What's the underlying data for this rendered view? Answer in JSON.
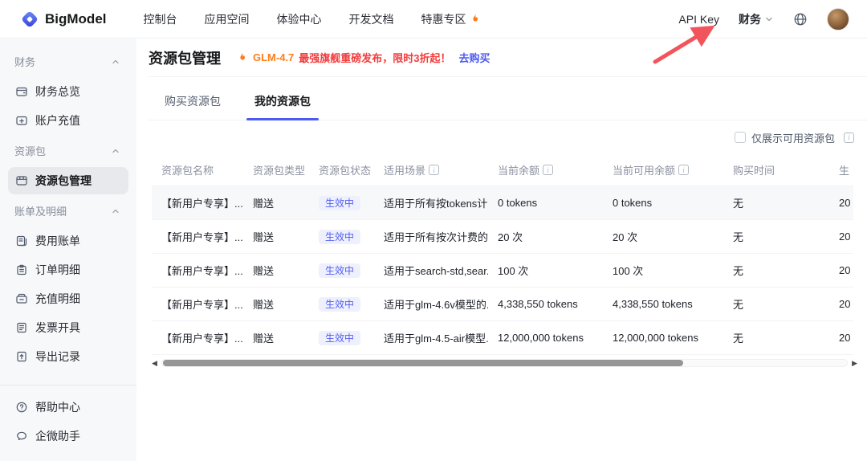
{
  "topbar": {
    "brand": "BigModel",
    "nav": [
      {
        "key": "console",
        "label": "控制台"
      },
      {
        "key": "app-space",
        "label": "应用空间"
      },
      {
        "key": "experience-center",
        "label": "体验中心"
      },
      {
        "key": "dev-docs",
        "label": "开发文档"
      },
      {
        "key": "promo-zone",
        "label": "特惠专区",
        "flame": true
      }
    ],
    "api_key_label": "API Key",
    "account_label": "财务",
    "annotation": {
      "type": "red-arrow",
      "points_to": "API Key",
      "color": "#f2545b"
    }
  },
  "sidebar": {
    "groups": [
      {
        "key": "finance",
        "label": "财务",
        "items": [
          {
            "key": "finance-overview",
            "icon": "wallet-icon",
            "label": "财务总览"
          },
          {
            "key": "account-recharge",
            "icon": "recharge-icon",
            "label": "账户充值"
          }
        ]
      },
      {
        "key": "resource-package",
        "label": "资源包",
        "items": [
          {
            "key": "resource-package-management",
            "icon": "package-icon",
            "label": "资源包管理",
            "active": true
          }
        ]
      },
      {
        "key": "bills-details",
        "label": "账单及明细",
        "items": [
          {
            "key": "expense-bills",
            "icon": "bill-icon",
            "label": "费用账单"
          },
          {
            "key": "order-details",
            "icon": "order-icon",
            "label": "订单明细"
          },
          {
            "key": "recharge-details",
            "icon": "recharge-detail-icon",
            "label": "充值明细"
          },
          {
            "key": "invoice-issue",
            "icon": "invoice-icon",
            "label": "发票开具"
          },
          {
            "key": "export-records",
            "icon": "export-icon",
            "label": "导出记录"
          }
        ]
      }
    ],
    "footer": [
      {
        "key": "help-center",
        "icon": "help-icon",
        "label": "帮助中心"
      },
      {
        "key": "wecom-assistant",
        "icon": "chat-icon",
        "label": "企微助手"
      }
    ]
  },
  "page": {
    "title": "资源包管理",
    "promo": {
      "highlight": "GLM-4.7",
      "text": "最强旗舰重磅发布，限时3折起！",
      "link": "去购买"
    },
    "tabs": [
      {
        "key": "buy-packages",
        "label": "购买资源包",
        "active": false
      },
      {
        "key": "my-packages",
        "label": "我的资源包",
        "active": true
      }
    ],
    "filter": {
      "label": "仅展示可用资源包",
      "checked": false
    }
  },
  "table": {
    "columns": [
      {
        "key": "name",
        "label": "资源包名称"
      },
      {
        "key": "type",
        "label": "资源包类型"
      },
      {
        "key": "status",
        "label": "资源包状态"
      },
      {
        "key": "scene",
        "label": "适用场景",
        "info": true
      },
      {
        "key": "balance",
        "label": "当前余额",
        "info": true
      },
      {
        "key": "available-balance",
        "label": "当前可用余额",
        "info": true
      },
      {
        "key": "purchase-time",
        "label": "购买时间"
      },
      {
        "key": "effective-time",
        "label": "生"
      }
    ],
    "rows": [
      {
        "name": "【新用户专享】...",
        "type": "赠送",
        "status": "生效中",
        "scene": "适用于所有按tokens计...",
        "balance": "0 tokens",
        "available": "0 tokens",
        "purchase_time": "无",
        "effective_time": "20"
      },
      {
        "name": "【新用户专享】...",
        "type": "赠送",
        "status": "生效中",
        "scene": "适用于所有按次计费的...",
        "balance": "20 次",
        "available": "20 次",
        "purchase_time": "无",
        "effective_time": "20"
      },
      {
        "name": "【新用户专享】...",
        "type": "赠送",
        "status": "生效中",
        "scene": "适用于search-std,sear...",
        "balance": "100 次",
        "available": "100 次",
        "purchase_time": "无",
        "effective_time": "20"
      },
      {
        "name": "【新用户专享】...",
        "type": "赠送",
        "status": "生效中",
        "scene": "适用于glm-4.6v模型的...",
        "balance": "4,338,550 tokens",
        "available": "4,338,550 tokens",
        "purchase_time": "无",
        "effective_time": "20"
      },
      {
        "name": "【新用户专享】...",
        "type": "赠送",
        "status": "生效中",
        "scene": "适用于glm-4.5-air模型...",
        "balance": "12,000,000 tokens",
        "available": "12,000,000 tokens",
        "purchase_time": "无",
        "effective_time": "20"
      }
    ]
  },
  "colors": {
    "accent": "#4d5bf0",
    "badge_text": "#5560f2",
    "badge_bg": "#eef0fe",
    "promo_orange": "#ff7d1a",
    "promo_red": "#f23c3c",
    "annotation_arrow": "#f2545b",
    "sidebar_bg": "#f7f8fa",
    "active_item_bg": "#e7e9ed"
  }
}
